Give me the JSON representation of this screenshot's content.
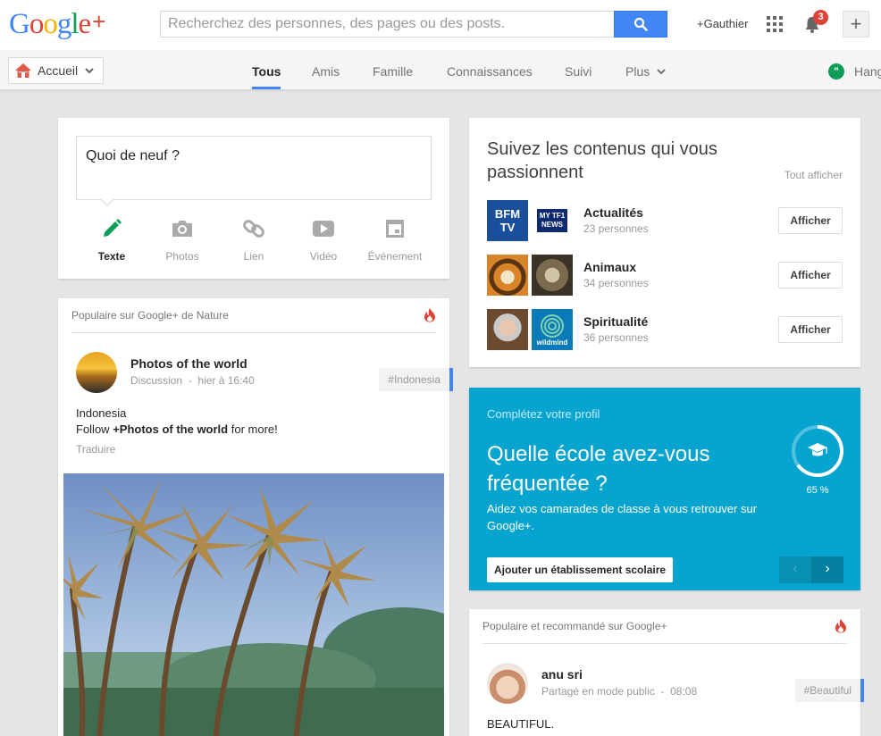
{
  "header": {
    "logo": [
      "G",
      "o",
      "o",
      "g",
      "l",
      "e",
      "+"
    ],
    "logo_colors": [
      "#4285f4",
      "#db4437",
      "#f4b400",
      "#4285f4",
      "#0f9d58",
      "#db4437",
      "#db4437"
    ],
    "search_placeholder": "Recherchez des personnes, des pages ou des posts.",
    "user_link": "+Gauthier",
    "notification_count": "3"
  },
  "nav": {
    "home_label": "Accueil",
    "tabs": [
      "Tous",
      "Amis",
      "Famille",
      "Connaissances",
      "Suivi",
      "Plus"
    ],
    "active_tab": "Tous",
    "hangouts_label": "Hang"
  },
  "share": {
    "prompt": "Quoi de neuf ?",
    "actions": [
      "Texte",
      "Photos",
      "Lien",
      "Vidéo",
      "Événement"
    ],
    "active_color": "#0f9d58"
  },
  "follow": {
    "title": "Suivez les contenus qui vous passionnent",
    "show_all": "Tout afficher",
    "topics": [
      {
        "name": "Actualités",
        "count": "23 personnes",
        "button": "Afficher",
        "img1_text": "BFM TV",
        "img2_text": "MY TF1 NEWS"
      },
      {
        "name": "Animaux",
        "count": "34 personnes",
        "button": "Afficher"
      },
      {
        "name": "Spiritualité",
        "count": "36 personnes",
        "button": "Afficher",
        "img2_text": "wildmind"
      }
    ]
  },
  "profile": {
    "label": "Complétez votre profil",
    "question": "Quelle école avez-vous fréquentée ?",
    "description": "Aidez vos camarades de classe à vous retrouver sur Google+.",
    "button": "Ajouter un établissement scolaire",
    "progress_text": "65 %",
    "progress": 0.65,
    "color": "#06a4cf"
  },
  "post1": {
    "popular_label": "Populaire sur Google+ de Nature",
    "author": "Photos of the world",
    "category": "Discussion",
    "time": "hier à 16:40",
    "tag": "#Indonesia",
    "line1": "Indonesia",
    "line2_prefix": "Follow ",
    "line2_bold": "+Photos of the world",
    "line2_suffix": " for more!",
    "translate": "Traduire"
  },
  "post2": {
    "popular_label": "Populaire et recommandé sur Google+",
    "author": "anu sri",
    "visibility": "Partagé en mode public",
    "time": "08:08",
    "tag": "#Beautiful",
    "text": "BEAUTIFUL."
  }
}
